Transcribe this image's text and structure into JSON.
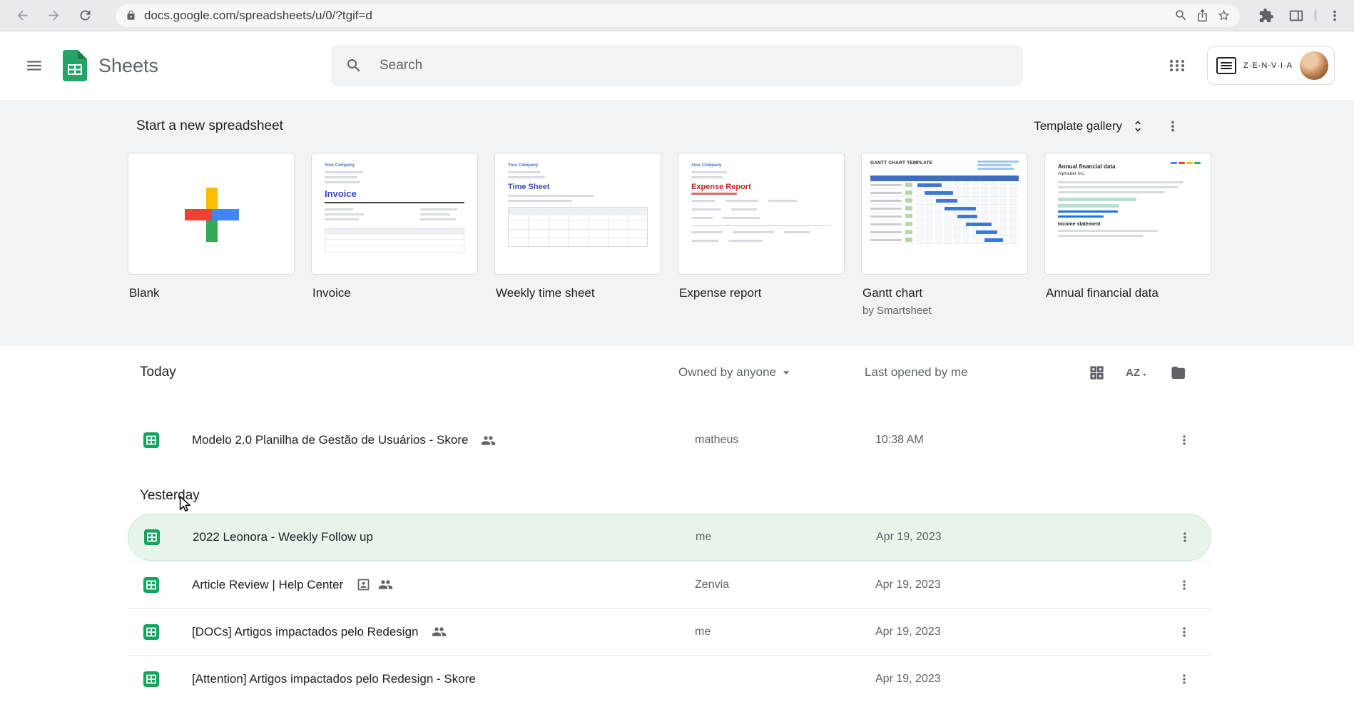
{
  "browser": {
    "url": "docs.google.com/spreadsheets/u/0/?tgif=d"
  },
  "app_header": {
    "title": "Sheets",
    "search_placeholder": "Search",
    "account_name": "Z·E·N·V·I·A"
  },
  "templates": {
    "section_title": "Start a new spreadsheet",
    "gallery_button": "Template gallery",
    "cards": [
      {
        "label": "Blank",
        "sublabel": ""
      },
      {
        "label": "Invoice",
        "sublabel": ""
      },
      {
        "label": "Weekly time sheet",
        "sublabel": ""
      },
      {
        "label": "Expense report",
        "sublabel": ""
      },
      {
        "label": "Gantt chart",
        "sublabel": "by Smartsheet"
      },
      {
        "label": "Annual financial data",
        "sublabel": ""
      }
    ],
    "thumbs": {
      "company": "Your Company",
      "invoice_title": "Invoice",
      "timesheet_title": "Time Sheet",
      "expense_title": "Expense Report",
      "gantt_title": "GANTT CHART TEMPLATE",
      "annual_title": "Annual financial data",
      "annual_company": "Alphabet Inc.",
      "annual_section": "Income statement"
    }
  },
  "file_list": {
    "columns": {
      "owner": "Owned by anyone",
      "last_opened": "Last opened by me"
    },
    "icons": {
      "sort_az": "AZ"
    },
    "sections": [
      {
        "label": "Today",
        "rows": [
          {
            "title": "Modelo 2.0 Planilha de Gestão de Usuários - Skore",
            "owner": "matheus",
            "opened": "10:38 AM"
          }
        ]
      },
      {
        "label": "Yesterday",
        "rows": [
          {
            "title": "2022 Leonora - Weekly Follow up",
            "owner": "me",
            "opened": "Apr 19, 2023"
          },
          {
            "title": "Article Review | Help Center",
            "owner": "Zenvia",
            "opened": "Apr 19, 2023"
          },
          {
            "title": "[DOCs] Artigos impactados pelo Redesign",
            "owner": "me",
            "opened": "Apr 19, 2023"
          },
          {
            "title": "[Attention] Artigos impactados pelo Redesign - Skore",
            "owner": "",
            "opened": "Apr 19, 2023"
          }
        ]
      }
    ]
  }
}
